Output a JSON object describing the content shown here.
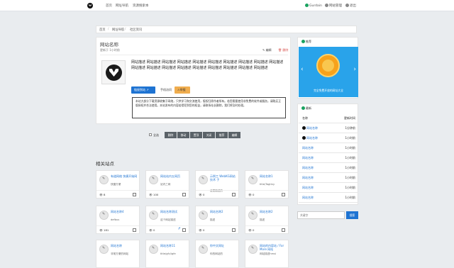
{
  "nav": {
    "links": [
      "首页",
      "网址导航",
      "资源搜索本"
    ],
    "user": "Gurdain",
    "admin": "网站管理",
    "logout": "退出"
  },
  "breadcrumb": [
    "首页",
    "网址导航",
    "社区资讯"
  ],
  "site": {
    "title": "网站名称",
    "updated": "更新于 1小时前",
    "edit": "编辑",
    "delete": "删除",
    "description": "网站描述 网站描述 网站描述 网站描述 网站描述 网站描述 网站描述 网站描述 网站描述 网站描述 网站描述 网站描述 网站描述 网站描述 网站描述 网站描述 网站描述 网站描述 网站描述",
    "visit_label": "链接到站 ↗",
    "mobile_label": "手机访问",
    "report_label": "⚠举报",
    "notice": "本站大部分下载资源收集于网络，只供学习和交流使用，版权归原作者所有。若您需要使用非免费的软件或服务，请购买正版授权并合法使用。本站发布的内容若侵犯到您的权益，请联系站长删除，我们将及时处理。"
  },
  "tags": {
    "checkbox_label": "全选",
    "items": [
      "删除",
      "移动",
      "置顶",
      "关闭",
      "推荐",
      "编辑"
    ]
  },
  "related": {
    "title": "相关站点",
    "cards": [
      {
        "name": "有道网络 快捷开始网",
        "sub": "快捷方便",
        "views": "👁 8"
      },
      {
        "name": "网站站内五网页",
        "sub": "站内三网",
        "views": "👁 100"
      },
      {
        "name": "示例工 WebKG网站 技术 子",
        "sub": "这是描述的",
        "views": "👁 0"
      },
      {
        "name": "网站名称1",
        "sub": "title/Tagtiny",
        "views": "👁 0"
      },
      {
        "name": "网站名称4",
        "sub": "defbus",
        "views": "👁 181"
      },
      {
        "name": "网站名称测试",
        "sub": "这个网站描述",
        "views": "👁 0"
      },
      {
        "name": "网站名称2",
        "sub": "描述",
        "views": "👁 0"
      },
      {
        "name": "网站名称2",
        "sub": "描述",
        "views": "👁 0"
      },
      {
        "name": "网站名称",
        "sub": "非常方便的网站",
        "views": ""
      },
      {
        "name": "网站名称11",
        "sub": "title/gfc/igfe",
        "views": ""
      },
      {
        "name": "你中文网址",
        "sub": "你的网站的",
        "views": ""
      },
      {
        "name": "网站的内容站 / For More 网站",
        "sub": "网站描述hmsi",
        "views": ""
      }
    ]
  },
  "sidebar": {
    "promo_head": "推荐",
    "banner_text": "完全免费开放的网址大全",
    "rank_head": "最新",
    "columns": [
      "名称",
      "更新时间"
    ],
    "rows": [
      {
        "name": "网站名称",
        "time": "1分钟前"
      },
      {
        "name": "网站名称",
        "time": "1小时前"
      },
      {
        "name": "网站名称",
        "time": "1小时前"
      },
      {
        "name": "网站名称",
        "time": "1小时前"
      },
      {
        "name": "网站名称",
        "time": "1小时前"
      },
      {
        "name": "网站名称",
        "time": "1小时前"
      },
      {
        "name": "网站名称",
        "time": "1小时前"
      },
      {
        "name": "网站名称",
        "time": "1小时前"
      }
    ],
    "search_placeholder": "关键字",
    "search_button": "搜索"
  },
  "colors": {
    "primary": "#1e73d2",
    "warning": "#f0ad4e",
    "banner": "#29a3ea",
    "danger": "#d9534f"
  }
}
